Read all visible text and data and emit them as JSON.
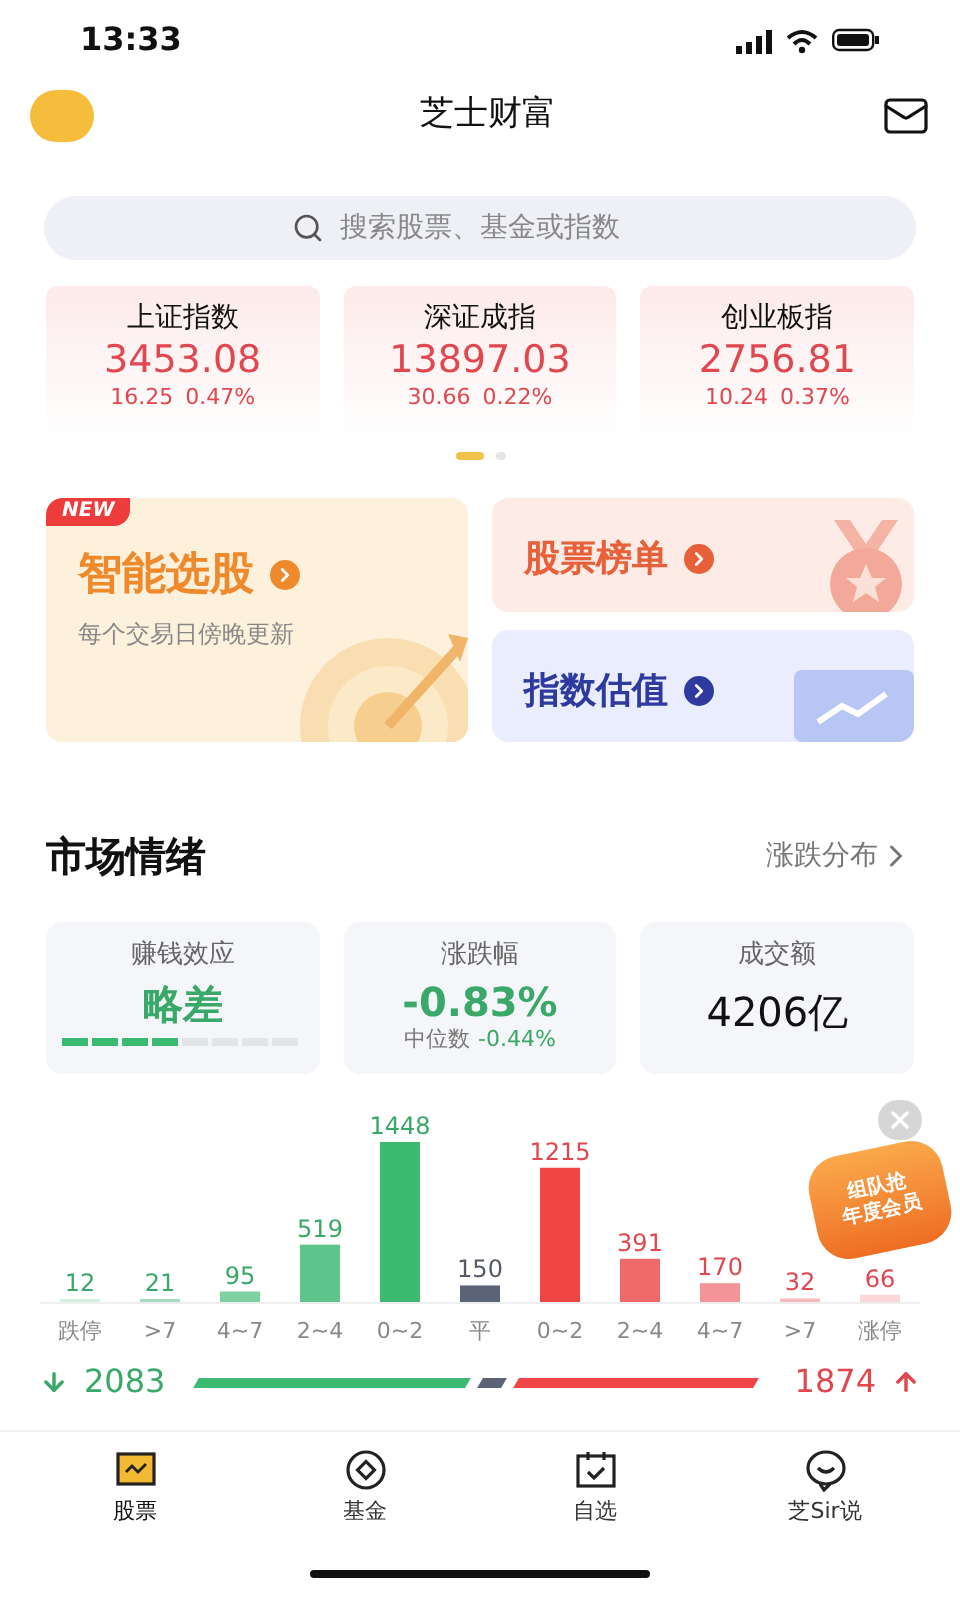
{
  "status_bar": {
    "time": "13:33"
  },
  "header": {
    "title": "芝士财富"
  },
  "search": {
    "placeholder": "搜索股票、基金或指数"
  },
  "indices": [
    {
      "name": "上证指数",
      "value": "3453.08",
      "change": "16.25",
      "percent": "0.47%"
    },
    {
      "name": "深证成指",
      "value": "13897.03",
      "change": "30.66",
      "percent": "0.22%"
    },
    {
      "name": "创业板指",
      "value": "2756.81",
      "change": "10.24",
      "percent": "0.37%"
    }
  ],
  "pager": [
    {
      "selected": true
    },
    {
      "selected": false
    }
  ],
  "features": [
    {
      "kind": "target",
      "title": "智能选股",
      "subtitle": "每个交易日傍晚更新",
      "badge": "NEW",
      "color": "#ee8a2c"
    },
    {
      "kind": "medal",
      "title": "股票榜单",
      "color": "#e8603a"
    },
    {
      "kind": "trend",
      "title": "指数估值",
      "color": "#2f3a9e"
    }
  ],
  "market": {
    "title": "市场情绪",
    "link": "涨跌分布",
    "stats": [
      {
        "kind": "meter",
        "label": "赚钱效应",
        "value": "略差",
        "level": 0.5
      },
      {
        "kind": "change",
        "label": "涨跌幅",
        "value": "-0.83%",
        "sub_label": "中位数",
        "sub_value": "-0.44%"
      },
      {
        "kind": "plain",
        "label": "成交额",
        "value": "4206亿"
      }
    ],
    "chart_data": {
      "type": "bar",
      "categories": [
        "跌停",
        ">7",
        "4~7",
        "2~4",
        "0~2",
        "平",
        "0~2",
        "2~4",
        "4~7",
        ">7",
        "涨停"
      ],
      "values": [
        12,
        21,
        95,
        519,
        1448,
        150,
        1215,
        391,
        170,
        32,
        66
      ],
      "data_labels": true
    },
    "totals": {
      "down": "2083",
      "up": "1874"
    }
  },
  "promo": {
    "lines": [
      "组队抢",
      "年度会员"
    ]
  },
  "tabs": [
    {
      "label": "股票",
      "selected": true
    },
    {
      "label": "基金",
      "selected": false
    },
    {
      "label": "自选",
      "selected": false
    },
    {
      "label": "芝Sir说",
      "selected": false
    }
  ]
}
